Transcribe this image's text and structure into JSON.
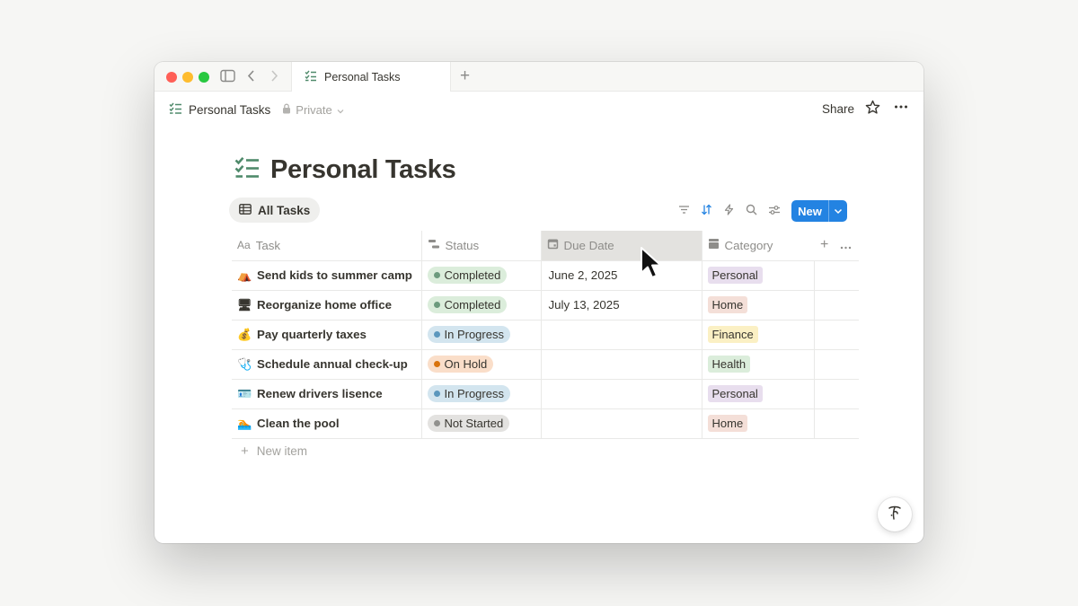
{
  "window": {
    "tab_title": "Personal Tasks",
    "new_tab_symbol": "+"
  },
  "topbar": {
    "breadcrumb": "Personal Tasks",
    "privacy": "Private",
    "share_label": "Share"
  },
  "page": {
    "title": "Personal Tasks"
  },
  "view": {
    "active_tab": "All Tasks",
    "new_button": "New"
  },
  "table": {
    "columns": [
      "Task",
      "Status",
      "Due Date",
      "Category"
    ],
    "rows": [
      {
        "emoji": "⛺",
        "task": "Send kids to summer camp",
        "status": "Completed",
        "due": "June 2, 2025",
        "category": "Personal"
      },
      {
        "emoji": "🖥",
        "task": "Reorganize home office",
        "status": "Completed",
        "due": "July 13, 2025",
        "category": "Home"
      },
      {
        "emoji": "💰",
        "task": "Pay quarterly taxes",
        "status": "In Progress",
        "due": "",
        "category": "Finance"
      },
      {
        "emoji": "🩺",
        "task": "Schedule annual check-up",
        "status": "On Hold",
        "due": "",
        "category": "Health"
      },
      {
        "emoji": "🪪",
        "task": "Renew drivers lisence",
        "status": "In Progress",
        "due": "",
        "category": "Personal"
      },
      {
        "emoji": "🏊",
        "task": "Clean the pool",
        "status": "Not Started",
        "due": "",
        "category": "Home"
      }
    ],
    "new_item_label": "New item"
  },
  "colors": {
    "accent": "#2383e2",
    "status": {
      "Completed": {
        "bg": "#dbeddb",
        "dot": "#6c9b7d"
      },
      "In Progress": {
        "bg": "#d3e5ef",
        "dot": "#5b97bd"
      },
      "On Hold": {
        "bg": "#fadec9",
        "dot": "#d9730d"
      },
      "Not Started": {
        "bg": "#e3e2e0",
        "dot": "#91918e"
      }
    },
    "category": {
      "Personal": "#e8deee",
      "Home": "#f4dfd8",
      "Finance": "#fbf0c4",
      "Health": "#dbeddb"
    }
  },
  "icons": [
    "checklist-icon",
    "lock-icon",
    "star-icon",
    "more-icon",
    "table-icon",
    "filter-icon",
    "sort-icon",
    "lightning-icon",
    "search-icon",
    "settings-icon",
    "calendar-icon",
    "status-icon",
    "text-type-icon",
    "category-icon",
    "help-icon",
    "cursor-icon"
  ]
}
